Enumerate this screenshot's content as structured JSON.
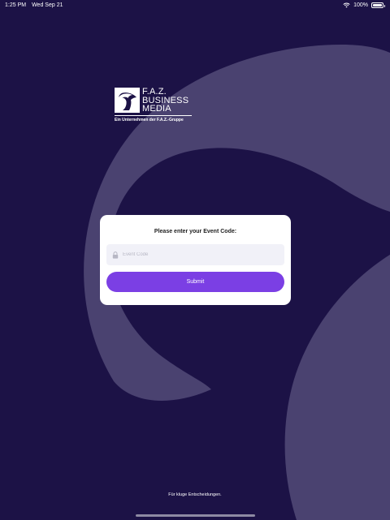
{
  "status_bar": {
    "time": "1:25 PM",
    "date": "Wed Sep 21",
    "battery": "100%",
    "battery_level": 1.0,
    "icons": [
      "wifi-icon",
      "battery-icon"
    ]
  },
  "logo": {
    "line1": "F.A.Z.",
    "line2": "BUSINESS",
    "line3": "MEDIA",
    "tagline": "Ein Unternehmen der F.A.Z.-Gruppe"
  },
  "login": {
    "title": "Please enter your Event Code:",
    "input_placeholder": "Event Code",
    "input_value": "",
    "input_icon": "lock-icon",
    "submit_label": "Submit"
  },
  "footer": {
    "slogan": "Für kluge Entscheidungen."
  },
  "colors": {
    "background": "#1c1246",
    "swoosh": "#4a4270",
    "accent": "#7b3fe4",
    "card": "#ffffff",
    "input_bg": "#f1f1f8"
  }
}
